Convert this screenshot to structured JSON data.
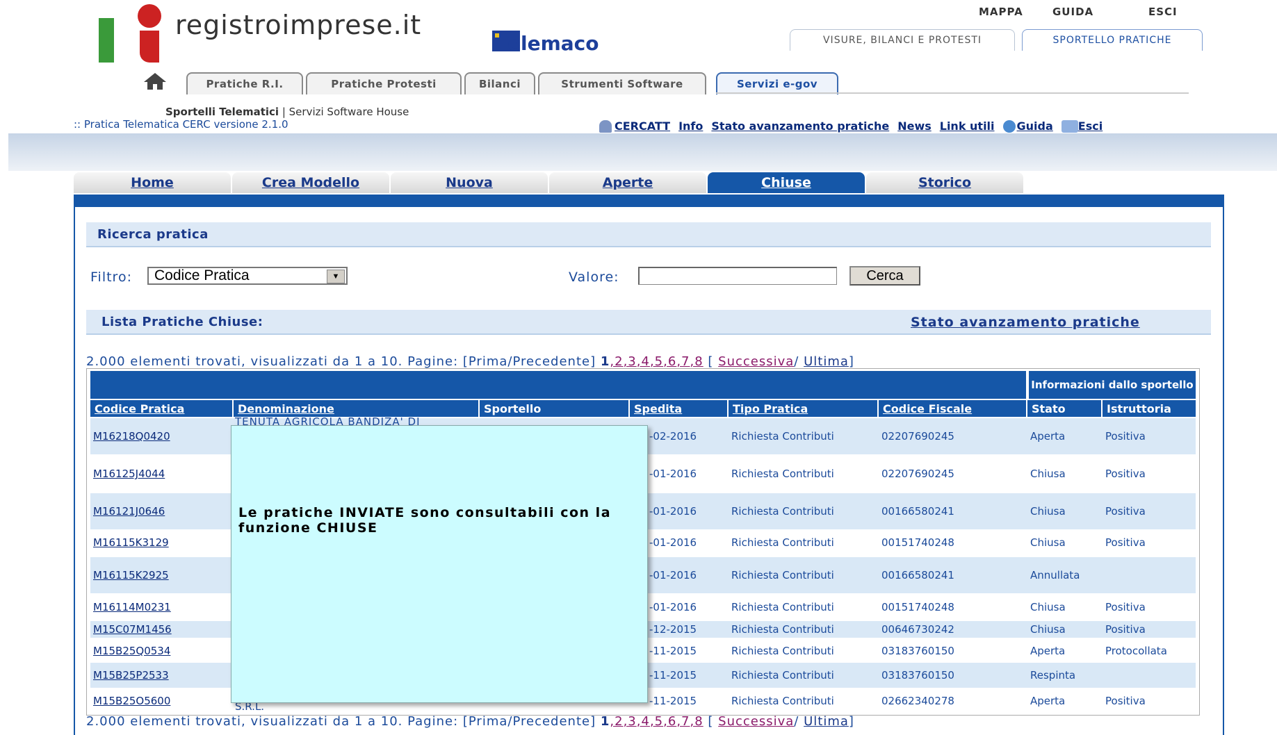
{
  "header": {
    "logo_text": "registroimprese.it",
    "telemaco_text": "elemaco",
    "top_links": [
      "MAPPA",
      "GUIDA",
      "ESCI"
    ],
    "section_tabs": [
      "VISURE, BILANCI E PROTESTI",
      "SPORTELLO PRATICHE"
    ],
    "main_tabs": [
      "Pratiche R.I.",
      "Pratiche Protesti",
      "Bilanci",
      "Strumenti Software",
      "Servizi e-gov"
    ],
    "subline_bold": "Sportelli Telematici",
    "subline_rest": "| Servizi Software House",
    "app_version": ":: Pratica Telematica CERC versione 2.1.0"
  },
  "toolbar": {
    "cercatt": "CERCATT",
    "info": "Info",
    "stato": "Stato avanzamento pratiche",
    "news": "News",
    "link_utili": "Link utili",
    "guida": "Guida",
    "esci": "Esci"
  },
  "app_tabs": [
    "Home",
    "Crea Modello",
    "Nuova",
    "Aperte",
    "Chiuse",
    "Storico"
  ],
  "search": {
    "title": "Ricerca pratica",
    "filter_label": "Filtro:",
    "filter_value": "Codice Pratica",
    "value_label": "Valore:",
    "value": "",
    "button": "Cerca"
  },
  "list": {
    "title": "Lista Pratiche Chiuse:",
    "stato_link": "Stato avanzamento pratiche",
    "pager_prefix": "2.000 elementi trovati, visualizzati da 1 a 10. Pagine: [Prima/Precedente]",
    "pager_current": "1",
    "pager_pages": [
      ",2",
      ",3",
      ",4",
      ",5",
      ",6",
      ",7",
      ",8"
    ],
    "pager_open": " [ ",
    "pager_next": "Successiva",
    "pager_slash": "/ ",
    "pager_last": "Ultima",
    "pager_close": "]"
  },
  "table": {
    "info_header": "Informazioni dallo sportello",
    "columns": [
      "Codice Pratica",
      "Denominazione",
      "Sportello",
      "Spedita",
      "Tipo Pratica",
      "Codice Fiscale",
      "Stato",
      "Istruttoria"
    ],
    "rows": [
      {
        "code": "M16218Q0420",
        "spedita": "-02-2016",
        "tipo": "Richiesta Contributi",
        "cf": "02207690245",
        "stato": "Aperta",
        "istr": "Positiva"
      },
      {
        "code": "M16125J4044",
        "spedita": "-01-2016",
        "tipo": "Richiesta Contributi",
        "cf": "02207690245",
        "stato": "Chiusa",
        "istr": "Positiva"
      },
      {
        "code": "M16121J0646",
        "spedita": "-01-2016",
        "tipo": "Richiesta Contributi",
        "cf": "00166580241",
        "stato": "Chiusa",
        "istr": "Positiva"
      },
      {
        "code": "M16115K3129",
        "spedita": "-01-2016",
        "tipo": "Richiesta Contributi",
        "cf": "00151740248",
        "stato": "Chiusa",
        "istr": "Positiva"
      },
      {
        "code": "M16115K2925",
        "spedita": "-01-2016",
        "tipo": "Richiesta Contributi",
        "cf": "00166580241",
        "stato": "Annullata",
        "istr": ""
      },
      {
        "code": "M16114M0231",
        "spedita": "-01-2016",
        "tipo": "Richiesta Contributi",
        "cf": "00151740248",
        "stato": "Chiusa",
        "istr": "Positiva"
      },
      {
        "code": "M15C07M1456",
        "spedita": "-12-2015",
        "tipo": "Richiesta Contributi",
        "cf": "00646730242",
        "stato": "Chiusa",
        "istr": "Positiva"
      },
      {
        "code": "M15B25Q0534",
        "spedita": "-11-2015",
        "tipo": "Richiesta Contributi",
        "cf": "03183760150",
        "stato": "Aperta",
        "istr": "Protocollata"
      },
      {
        "code": "M15B25P2533",
        "spedita": "-11-2015",
        "tipo": "Richiesta Contributi",
        "cf": "03183760150",
        "stato": "Respinta",
        "istr": ""
      },
      {
        "code": "M15B25O5600",
        "spedita": "-11-2015",
        "tipo": "Richiesta Contributi",
        "cf": "02662340278",
        "stato": "Aperta",
        "istr": "Positiva"
      }
    ],
    "peek_top": "TENUTA AGRICOLA BANDIZA' DI",
    "peek_bottom": "S.R.L."
  },
  "tooltip": {
    "text": "Le pratiche INVIATE sono consultabili con la funzione CHIUSE"
  }
}
